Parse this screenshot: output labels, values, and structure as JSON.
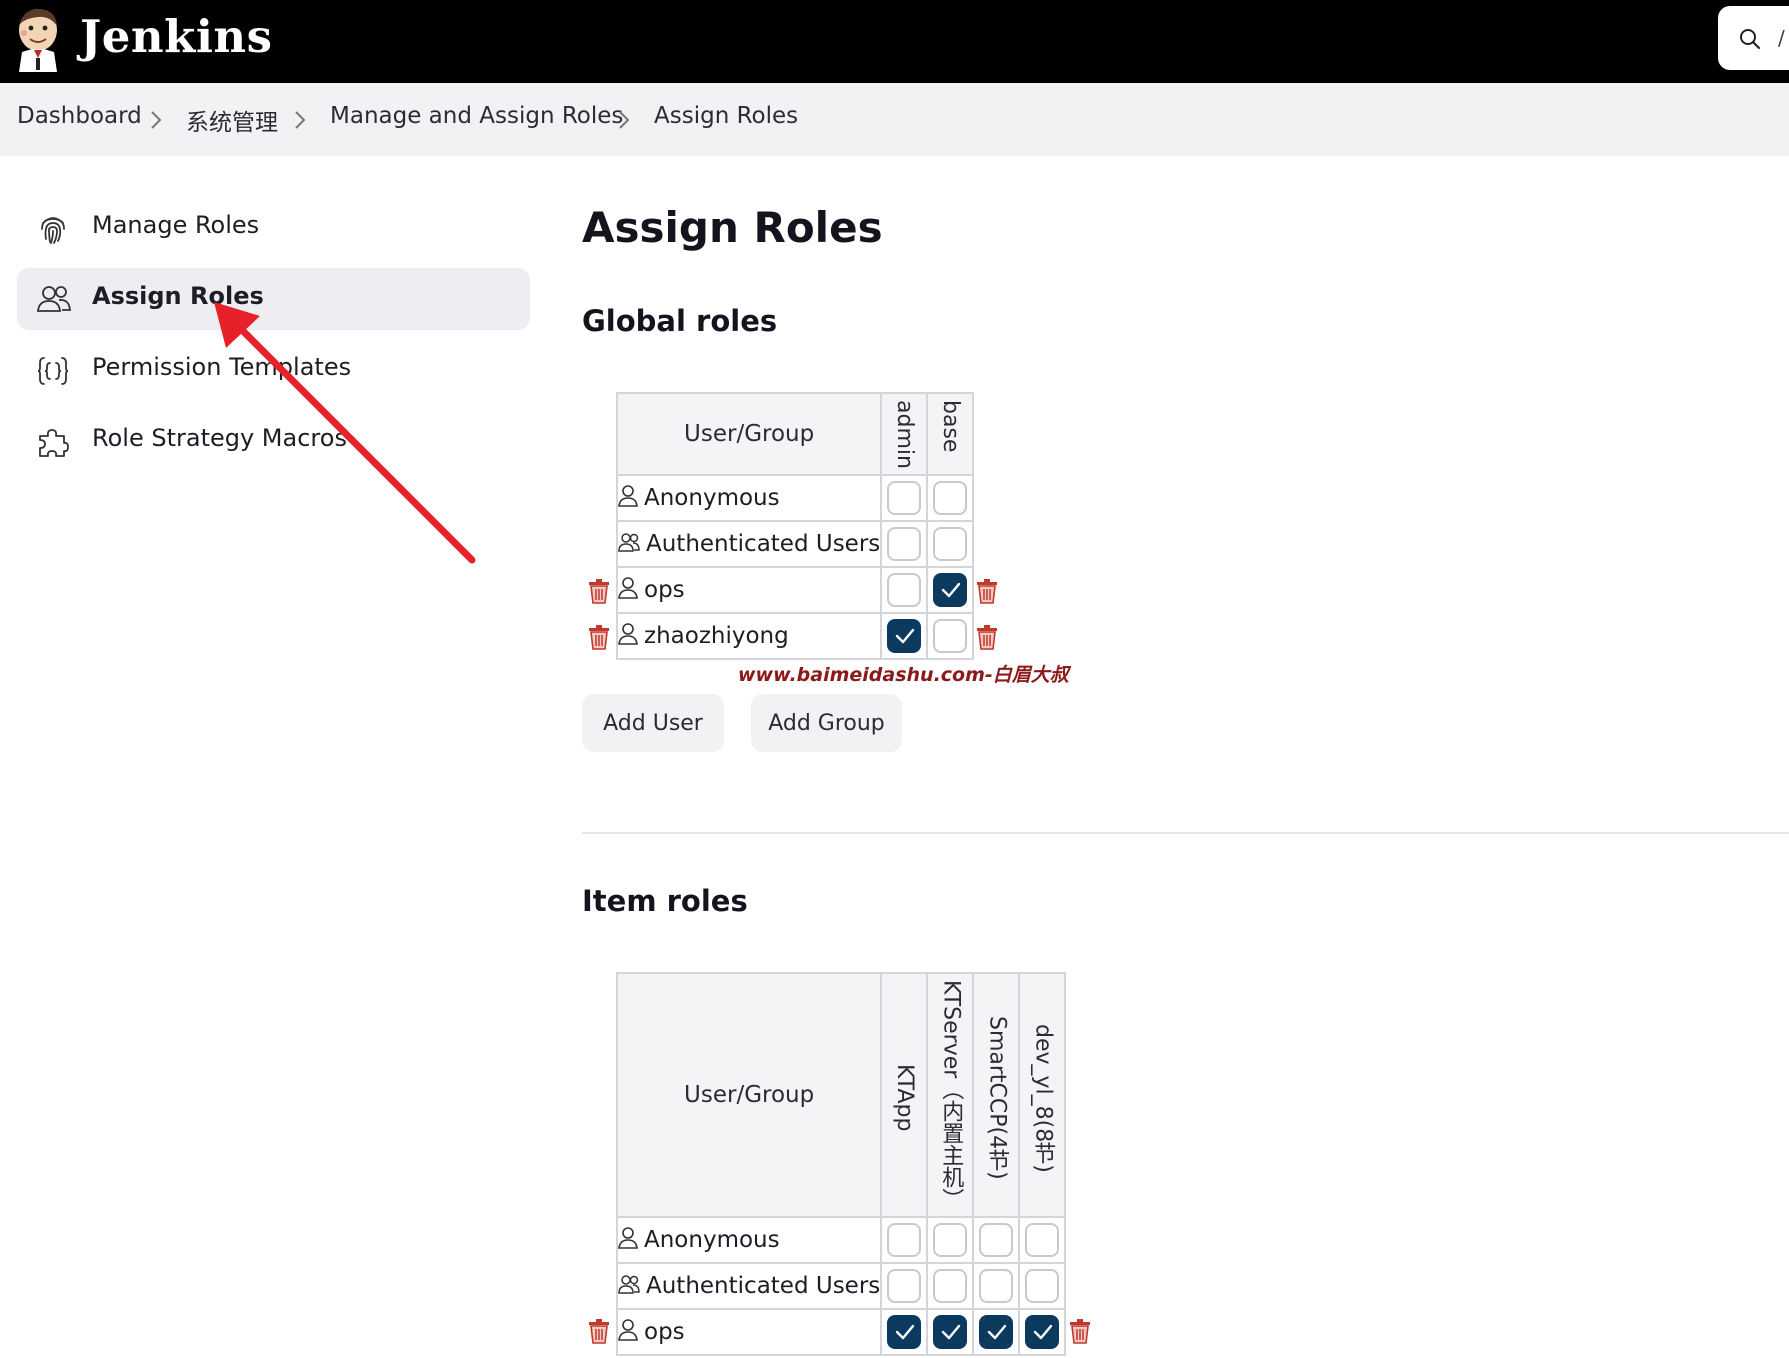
{
  "header": {
    "brand": "Jenkins",
    "search_shortcut": "/"
  },
  "breadcrumb": [
    "Dashboard",
    "系统管理",
    "Manage and Assign Roles",
    "Assign Roles"
  ],
  "sidebar": {
    "items": [
      {
        "label": "Manage Roles",
        "icon": "fingerprint-icon",
        "active": false
      },
      {
        "label": "Assign Roles",
        "icon": "users-icon",
        "active": true
      },
      {
        "label": "Permission Templates",
        "icon": "braces-icon",
        "active": false
      },
      {
        "label": "Role Strategy Macros",
        "icon": "puzzle-icon",
        "active": false
      }
    ]
  },
  "page": {
    "title": "Assign Roles"
  },
  "global_roles": {
    "heading": "Global roles",
    "column_header": "User/Group",
    "roles": [
      "admin",
      "base"
    ],
    "rows": [
      {
        "name": "Anonymous",
        "type": "user",
        "deletable": false,
        "checked": [
          false,
          false
        ]
      },
      {
        "name": "Authenticated Users",
        "type": "group",
        "deletable": false,
        "checked": [
          false,
          false
        ]
      },
      {
        "name": "ops",
        "type": "user",
        "deletable": true,
        "checked": [
          false,
          true
        ]
      },
      {
        "name": "zhaozhiyong",
        "type": "user",
        "deletable": true,
        "checked": [
          true,
          false
        ]
      }
    ],
    "buttons": {
      "add_user": "Add User",
      "add_group": "Add Group"
    }
  },
  "watermark": "www.baimeidashu.com-白眉大叔",
  "item_roles": {
    "heading": "Item roles",
    "column_header": "User/Group",
    "roles": [
      "KTApp",
      "KTServer（内置主机）",
      "SmartCCP(4节)",
      "dev_yl_8(8节)"
    ],
    "rows": [
      {
        "name": "Anonymous",
        "type": "user",
        "deletable": false,
        "checked": [
          false,
          false,
          false,
          false
        ]
      },
      {
        "name": "Authenticated Users",
        "type": "group",
        "deletable": false,
        "checked": [
          false,
          false,
          false,
          false
        ]
      },
      {
        "name": "ops",
        "type": "user",
        "deletable": true,
        "checked": [
          true,
          true,
          true,
          true
        ]
      }
    ]
  },
  "colors": {
    "topbar": "#000000",
    "checked": "#0b3a5e",
    "delete_icon": "#c0392b",
    "annotation_arrow": "#e8202a"
  }
}
